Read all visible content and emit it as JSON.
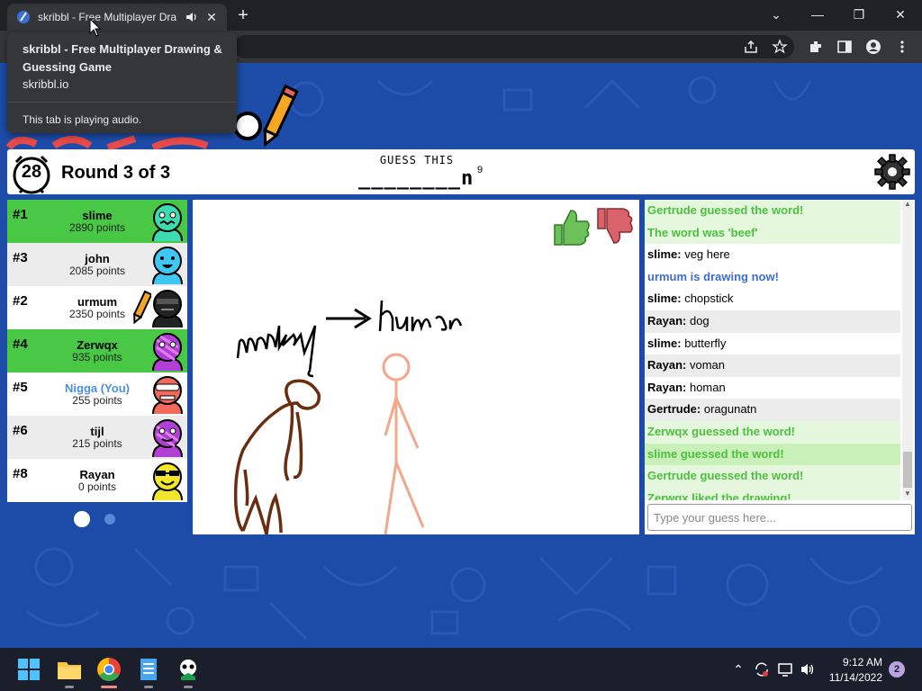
{
  "browser": {
    "tab_title": "skribbl - Free Multiplayer Dra",
    "close_symbol": "✕",
    "new_tab_symbol": "+",
    "window_controls": {
      "minimize": "—",
      "restore": "❐",
      "close": "✕",
      "dropdown": "⌄"
    }
  },
  "tooltip": {
    "title": "skribbl - Free Multiplayer Drawing & Guessing Game",
    "url": "skribbl.io",
    "audio_note": "This tab is playing audio."
  },
  "game": {
    "timer": "28",
    "round": "Round 3 of 3",
    "guess_label": "GUESS THIS",
    "word_hint": "________n",
    "word_length": "9"
  },
  "players": [
    {
      "rank": "#1",
      "name": "slime",
      "points": "2890 points",
      "bg": "green",
      "color": "#3ddcb0"
    },
    {
      "rank": "#3",
      "name": "john",
      "points": "2085 points",
      "bg": "gray",
      "color": "#3ec7f2"
    },
    {
      "rank": "#2",
      "name": "urmum",
      "points": "2350 points",
      "bg": "white",
      "color": "#222222"
    },
    {
      "rank": "#4",
      "name": "Zerwqx",
      "points": "935 points",
      "bg": "green",
      "color": "#b13fd6"
    },
    {
      "rank": "#5",
      "name": "Nigga (You)",
      "points": "255 points",
      "bg": "white",
      "color": "#f26a5b"
    },
    {
      "rank": "#6",
      "name": "tijl",
      "points": "215 points",
      "bg": "gray",
      "color": "#b13fd6"
    },
    {
      "rank": "#8",
      "name": "Rayan",
      "points": "0 points",
      "bg": "white",
      "color": "#f2e52b"
    }
  ],
  "chat": [
    {
      "type": "green",
      "text": "Gertrude guessed the word!"
    },
    {
      "type": "green",
      "text": "The word was 'beef'"
    },
    {
      "type": "normal",
      "who": "slime:",
      "text": " veg here"
    },
    {
      "type": "blue",
      "text": "urmum is drawing now!"
    },
    {
      "type": "normal",
      "who": "slime:",
      "text": " chopstick"
    },
    {
      "type": "alt",
      "who": "Rayan:",
      "text": " dog"
    },
    {
      "type": "normal",
      "who": "slime:",
      "text": " butterfly"
    },
    {
      "type": "alt",
      "who": "Rayan:",
      "text": " voman"
    },
    {
      "type": "normal",
      "who": "Rayan:",
      "text": " homan"
    },
    {
      "type": "alt",
      "who": "Gertrude:",
      "text": " oragunatn"
    },
    {
      "type": "green",
      "text": "Zerwqx guessed the word!"
    },
    {
      "type": "green2",
      "text": "slime guessed the word!"
    },
    {
      "type": "green",
      "text": "Gertrude guessed the word!"
    },
    {
      "type": "green",
      "text": "Zerwqx liked the drawing!"
    }
  ],
  "guess_placeholder": "Type your guess here...",
  "taskbar": {
    "time": "9:12 AM",
    "date": "11/14/2022",
    "notifications": "2"
  }
}
